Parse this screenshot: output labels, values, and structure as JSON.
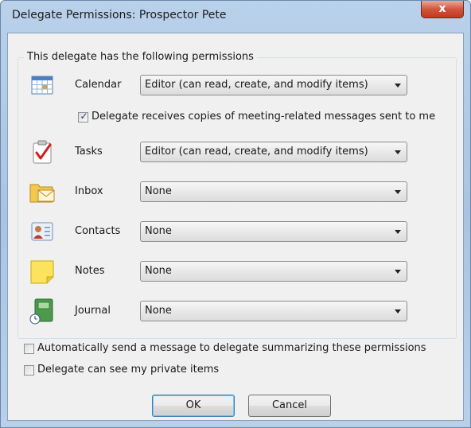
{
  "window": {
    "title": "Delegate Permissions: Prospector Pete",
    "close_glyph": "x"
  },
  "group": {
    "legend": "This delegate has the following permissions"
  },
  "permissions": [
    {
      "label": "Calendar",
      "icon": "calendar-icon",
      "value": "Editor (can read, create, and modify items)"
    },
    {
      "label": "Tasks",
      "icon": "tasks-icon",
      "value": "Editor (can read, create, and modify items)"
    },
    {
      "label": "Inbox",
      "icon": "inbox-icon",
      "value": "None"
    },
    {
      "label": "Contacts",
      "icon": "contacts-icon",
      "value": "None"
    },
    {
      "label": "Notes",
      "icon": "notes-icon",
      "value": "None"
    },
    {
      "label": "Journal",
      "icon": "journal-icon",
      "value": "None"
    }
  ],
  "meeting_copies": {
    "label": "Delegate receives copies of meeting-related messages sent to me",
    "checked": true
  },
  "options": {
    "auto_send": {
      "label": "Automatically send a message to delegate summarizing these permissions",
      "checked": false
    },
    "private_items": {
      "label": "Delegate can see my private items",
      "checked": false
    }
  },
  "buttons": {
    "ok": "OK",
    "cancel": "Cancel"
  },
  "colors": {
    "title_bar": "#b9d1ea",
    "close_button": "#c4371f",
    "dialog_background": "#f0f0f0",
    "default_button_border": "#3c7fb1"
  }
}
